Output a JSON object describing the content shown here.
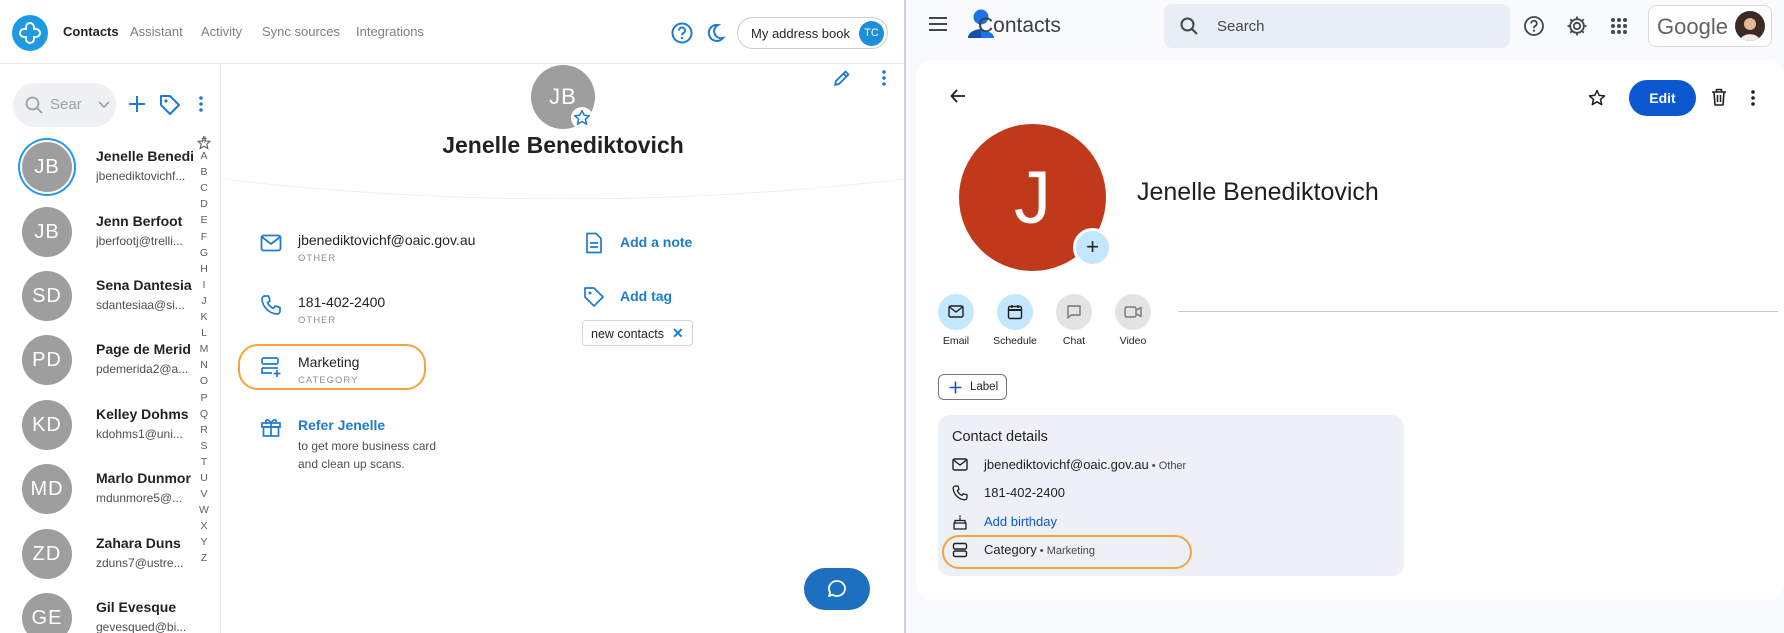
{
  "left_app": {
    "nav": [
      "Contacts",
      "Assistant",
      "Activity",
      "Sync sources",
      "Integrations"
    ],
    "address_book": "My address book",
    "user_initials": "TC",
    "search_placeholder": "Sear",
    "contacts": [
      {
        "initials": "JB",
        "name": "Jenelle Benedi",
        "email": "jbenediktovichf..."
      },
      {
        "initials": "JB",
        "name": "Jenn Berfoot",
        "email": "jberfootj@trelli..."
      },
      {
        "initials": "SD",
        "name": "Sena Dantesia",
        "email": "sdantesiaa@si..."
      },
      {
        "initials": "PD",
        "name": "Page de Merid",
        "email": "pdemerida2@a..."
      },
      {
        "initials": "KD",
        "name": "Kelley Dohms",
        "email": "kdohms1@uni..."
      },
      {
        "initials": "MD",
        "name": "Marlo Dunmor",
        "email": "mdunmore5@..."
      },
      {
        "initials": "ZD",
        "name": "Zahara Duns",
        "email": "zduns7@ustre..."
      },
      {
        "initials": "GE",
        "name": "Gil Evesque",
        "email": "gevesqued@bi..."
      }
    ],
    "alphabet": [
      "#",
      "A",
      "B",
      "C",
      "D",
      "E",
      "F",
      "G",
      "H",
      "I",
      "J",
      "K",
      "L",
      "M",
      "N",
      "O",
      "P",
      "Q",
      "R",
      "S",
      "T",
      "U",
      "V",
      "W",
      "X",
      "Y",
      "Z"
    ],
    "detail": {
      "initials": "JB",
      "name": "Jenelle Benediktovich",
      "email": "jbenediktovichf@oaic.gov.au",
      "email_type": "OTHER",
      "phone": "181-402-2400",
      "phone_type": "OTHER",
      "category": "Marketing",
      "category_label": "CATEGORY",
      "refer_title": "Refer Jenelle",
      "refer_line1": "to get more business card",
      "refer_line2": "and clean up scans.",
      "add_note": "Add a note",
      "add_tag": "Add tag",
      "tag": "new contacts"
    }
  },
  "right_app": {
    "title": "Contacts",
    "search_placeholder": "Search",
    "brand": "Google",
    "edit_label": "Edit",
    "initial": "J",
    "name": "Jenelle Benediktovich",
    "quick_actions": [
      "Email",
      "Schedule",
      "Chat",
      "Video"
    ],
    "label_button": "Label",
    "contact_details": {
      "title": "Contact details",
      "email": "jbenediktovichf@oaic.gov.au",
      "email_type": "Other",
      "phone": "181-402-2400",
      "add_birthday": "Add birthday",
      "category_key": "Category",
      "category_value": "Marketing"
    },
    "colors": {
      "accent": "#0b57d0",
      "avatar": "#c0391b"
    }
  }
}
